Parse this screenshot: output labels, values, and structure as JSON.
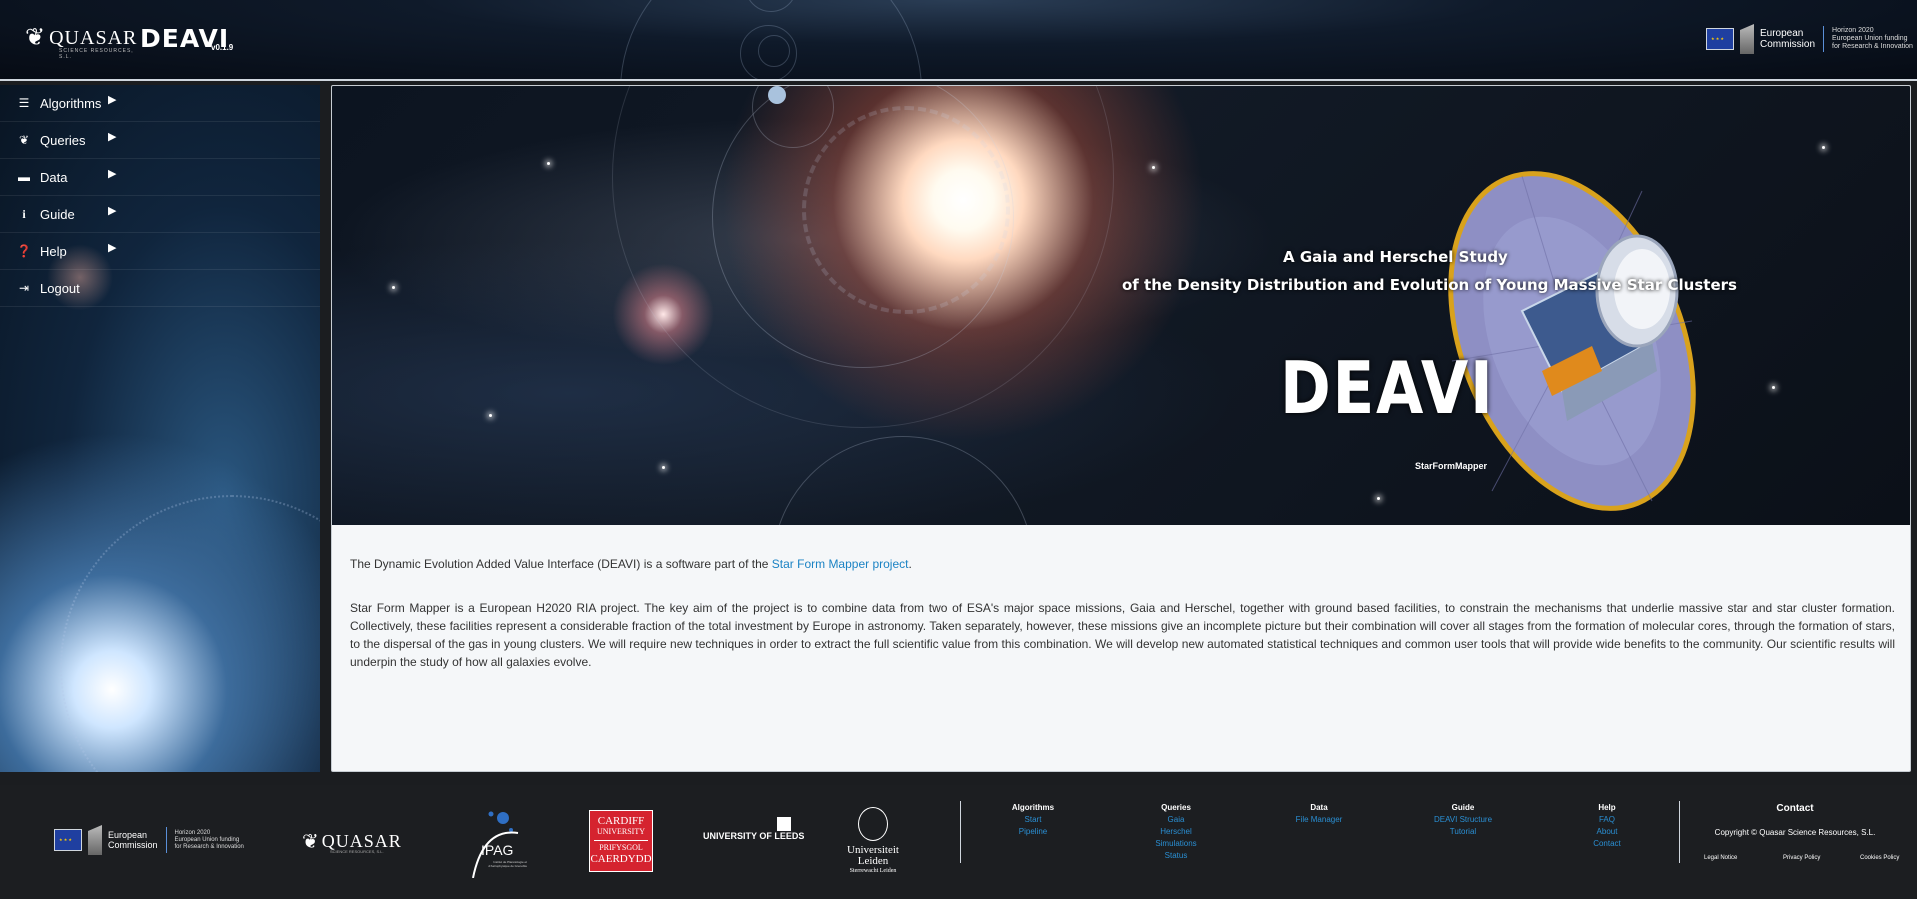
{
  "header": {
    "brand": "QUASAR",
    "brand_sub": "SCIENCE RESOURCES, S.L.",
    "app_title": "DEAVI",
    "app_version": "v0.1.9",
    "ec_name_line1": "European",
    "ec_name_line2": "Commission",
    "h2020_line1": "Horizon 2020",
    "h2020_line2": "European Union funding",
    "h2020_line3": "for Research & Innovation"
  },
  "sidebar": {
    "items": [
      {
        "label": "Algorithms",
        "icon": "list-icon",
        "has_submenu": true
      },
      {
        "label": "Queries",
        "icon": "leaf-icon",
        "has_submenu": true
      },
      {
        "label": "Data",
        "icon": "hdd-icon",
        "has_submenu": true
      },
      {
        "label": "Guide",
        "icon": "info-icon",
        "has_submenu": true
      },
      {
        "label": "Help",
        "icon": "question-circle-icon",
        "has_submenu": true
      },
      {
        "label": "Logout",
        "icon": "sign-out-icon",
        "has_submenu": false
      }
    ]
  },
  "hero": {
    "subtitle_line1": "A Gaia and Herschel Study",
    "subtitle_line2": "of the Density Distribution and Evolution of Young Massive Star Clusters",
    "title": "DEAVI",
    "tag": "StarFormMapper"
  },
  "content": {
    "intro_prefix": "The Dynamic Evolution Added Value Interface (DEAVI) is a software part of the ",
    "intro_link": "Star Form Mapper project",
    "intro_suffix": ".",
    "body": "Star Form Mapper is a European H2020 RIA project. The key aim of the project is to combine data from two of ESA's major space missions, Gaia and Herschel, together with ground based facilities, to constrain the mechanisms that underlie massive star and star cluster formation. Collectively, these facilities represent a considerable fraction of the total investment by Europe in astronomy. Taken separately, however, these missions give an incomplete picture but their combination will cover all stages from the formation of molecular cores, through the formation of stars, to the dispersal of the gas in young clusters. We will require new techniques in order to extract the full scientific value from this combination. We will develop new automated statistical techniques and common user tools that will provide wide benefits to the community. Our scientific results will underpin the study of how all galaxies evolve."
  },
  "footer": {
    "logos": {
      "ec_line1": "European",
      "ec_line2": "Commission",
      "h2020_line1": "Horizon 2020",
      "h2020_line2": "European Union funding",
      "h2020_line3": "for Research & Innovation",
      "quasar": "QUASAR",
      "quasar_sub": "SCIENCE RESOURCES, S.L.",
      "ipag": "IPAG",
      "ipag_sub": "Institut de Planétologie et d'Astrophysique de Grenoble",
      "cardiff_line1": "CARDIFF",
      "cardiff_line2": "UNIVERSITY",
      "cardiff_line3": "PRIFYSGOL",
      "cardiff_line4": "CAERDYDD",
      "leeds": "UNIVERSITY OF LEEDS",
      "leiden_line1": "Universiteit",
      "leiden_line2": "Leiden",
      "leiden_sub": "Sterrewacht Leiden"
    },
    "columns": [
      {
        "title": "Algorithms",
        "links": [
          "Start",
          "Pipeline"
        ]
      },
      {
        "title": "Queries",
        "links": [
          "Gaia",
          "Herschel",
          "Simulations",
          "Status"
        ]
      },
      {
        "title": "Data",
        "links": [
          "File Manager"
        ]
      },
      {
        "title": "Guide",
        "links": [
          "DEAVI Structure",
          "Tutorial"
        ]
      },
      {
        "title": "Help",
        "links": [
          "FAQ",
          "About",
          "Contact"
        ]
      }
    ],
    "contact": {
      "title": "Contact",
      "copyright": "Copyright © Quasar Science Resources, S.L.",
      "legal": [
        "Legal Notice",
        "Privacy Policy",
        "Cookies Policy"
      ]
    }
  }
}
